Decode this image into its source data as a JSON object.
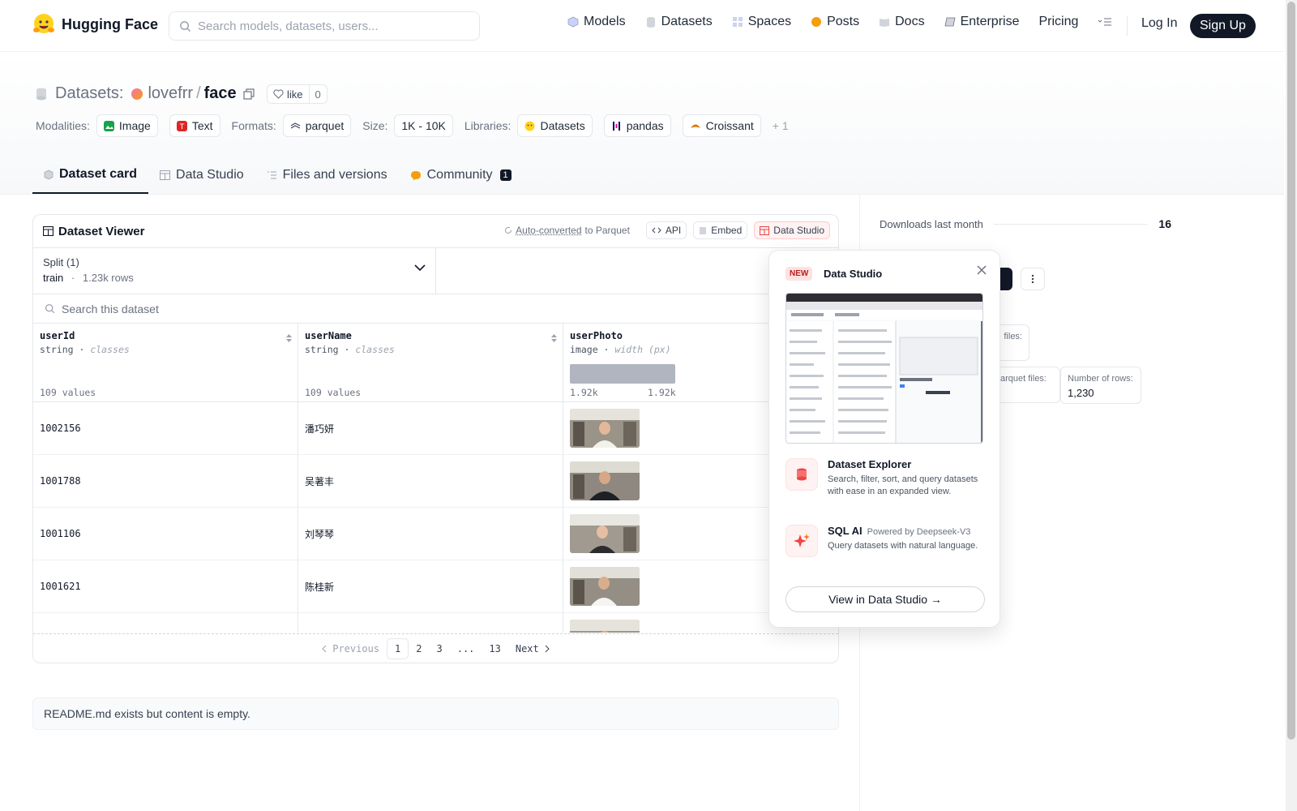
{
  "nav": {
    "brand": "Hugging Face",
    "search_placeholder": "Search models, datasets, users...",
    "links": [
      "Models",
      "Datasets",
      "Spaces",
      "Posts",
      "Docs",
      "Enterprise",
      "Pricing"
    ],
    "login": "Log In",
    "signup": "Sign Up"
  },
  "header": {
    "section": "Datasets:",
    "owner": "lovefrr",
    "separator": "/",
    "dataset": "face",
    "like_label": "like",
    "like_count": "0",
    "modalities_label": "Modalities:",
    "modalities": [
      "Image",
      "Text"
    ],
    "formats_label": "Formats:",
    "formats": [
      "parquet"
    ],
    "size_label": "Size:",
    "size": "1K - 10K",
    "libraries_label": "Libraries:",
    "libraries": [
      "Datasets",
      "pandas",
      "Croissant"
    ],
    "libraries_more": "+ 1"
  },
  "tabs": {
    "items": [
      "Dataset card",
      "Data Studio",
      "Files and versions",
      "Community"
    ],
    "community_badge": "1"
  },
  "viewer": {
    "title": "Dataset Viewer",
    "auto_converted": "Auto-converted",
    "to_parquet": "to Parquet",
    "api": "API",
    "embed": "Embed",
    "data_studio": "Data Studio",
    "split_label": "Split (1)",
    "split_name": "train",
    "split_dot": "·",
    "split_rows": "1.23k rows",
    "search_placeholder": "Search this dataset",
    "columns": [
      {
        "name": "userId",
        "type": "string",
        "kind": "classes",
        "stat": "109 values"
      },
      {
        "name": "userName",
        "type": "string",
        "kind": "classes",
        "stat": "109 values"
      },
      {
        "name": "userPhoto",
        "type": "image",
        "kind": "width (px)",
        "min": "1.92k",
        "max": "1.92k"
      }
    ],
    "type_sep": " · ",
    "rows": [
      {
        "id": "1002156",
        "name": "潘巧妍"
      },
      {
        "id": "1001788",
        "name": "吴著丰"
      },
      {
        "id": "1001106",
        "name": "刘琴琴"
      },
      {
        "id": "1001621",
        "name": "陈桂新"
      }
    ],
    "pager": {
      "prev": "Previous",
      "pages": [
        "1",
        "2",
        "3",
        "...",
        "13"
      ],
      "next": "Next"
    }
  },
  "readme": "README.md exists but content is empty.",
  "sidebar": {
    "downloads_label": "Downloads last month",
    "downloads": "16",
    "files_label": "files:",
    "parquet_label": "arquet files:",
    "rows_label": "Number of rows:",
    "rows_value": "1,230"
  },
  "popup": {
    "new_badge": "NEW",
    "title": "Data Studio",
    "explorer_title": "Dataset Explorer",
    "explorer_desc": "Search, filter, sort, and query datasets with ease in an expanded view.",
    "sql_title": "SQL AI",
    "sql_powered": "Powered by Deepseek-V3",
    "sql_desc": "Query datasets with natural language.",
    "cta": "View in Data Studio →"
  }
}
